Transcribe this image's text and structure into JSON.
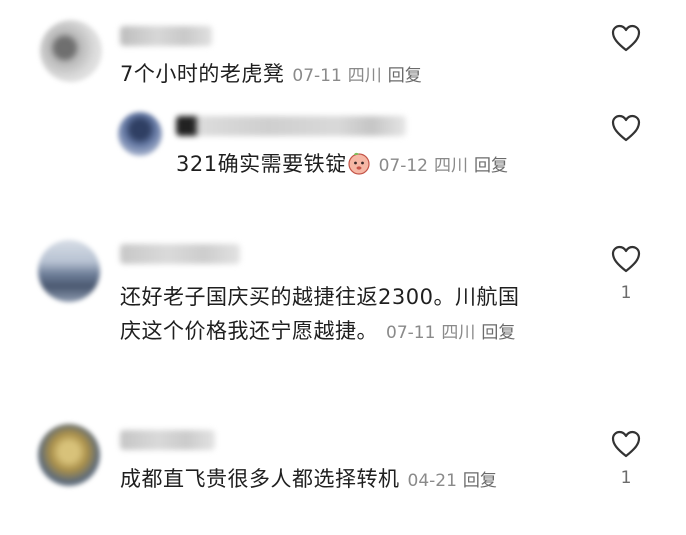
{
  "comments": [
    {
      "username": "虞十涵人",
      "text": "7个小时的老虎凳",
      "date": "07-11",
      "location": "四川",
      "reply_label": "回复",
      "likes": "",
      "replies": [
        {
          "username": "bluesed1212 回复",
          "text": "321确实需要铁锭",
          "emoji": "peach-face-emoji",
          "date": "07-12",
          "location": "四川",
          "reply_label": "回复",
          "likes": ""
        }
      ]
    },
    {
      "username": "tangtuanv",
      "text_line1": "还好老子国庆买的越捷往返2300。川航国",
      "text_line2": "庆这个价格我还宁愿越捷。",
      "date": "07-11",
      "location": "四川",
      "reply_label": "回复",
      "likes": "1"
    },
    {
      "username": "mumuko",
      "text": "成都直飞贵很多人都选择转机",
      "date": "04-21",
      "location": "",
      "reply_label": "回复",
      "likes": "1"
    }
  ],
  "colors": {
    "text": "#1f1f1f",
    "meta": "#8a8a8a",
    "icon": "#333333"
  }
}
